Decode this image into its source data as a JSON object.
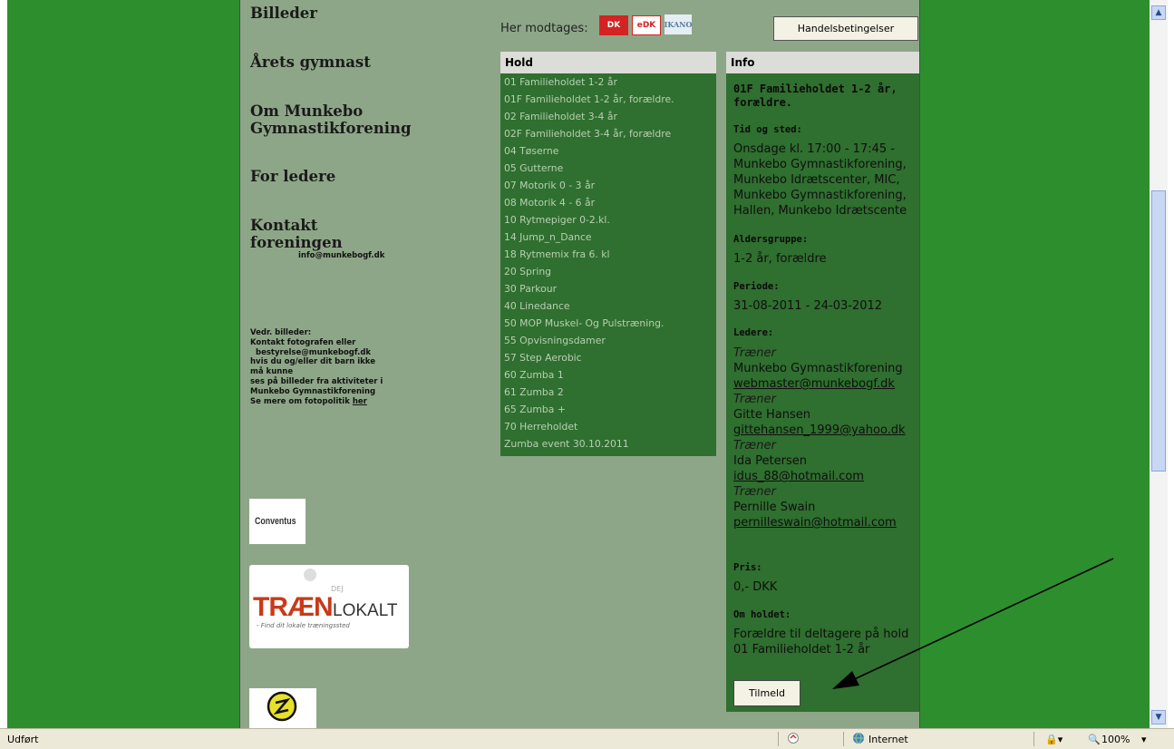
{
  "sidebar": {
    "items": [
      {
        "label": "Billeder"
      },
      {
        "label": "Årets gymnast"
      },
      {
        "label": "Om Munkebo Gymnastikforening"
      },
      {
        "label": "For ledere"
      },
      {
        "label": "Kontakt foreningen"
      }
    ],
    "contact_email": "info@munkebogf.dk",
    "photo_note": {
      "line1": "Vedr. billeder:",
      "line2": "Kontakt fotografen eller",
      "line3": "bestyrelse@munkebogf.dk",
      "line4": "hvis du og/eller dit barn ikke",
      "line5": "må kunne",
      "line6": "ses på billeder fra aktiviteter i",
      "line7": "Munkebo Gymnastikforening",
      "line8_prefix": "Se mere om fotopolitik ",
      "link": "her"
    },
    "logos": {
      "conventus": "Conventus",
      "traen_big": "TRÆN",
      "traen_small": "LOKALT",
      "traen_tagline": "- Find dit lokale træningssted",
      "traen_dej": "DEJ"
    }
  },
  "payment": {
    "label": "Her modtages:",
    "cards": [
      "DK",
      "eDK",
      "IKANO"
    ]
  },
  "terms_button": "Handelsbetingelser",
  "hold": {
    "header": "Hold",
    "items": [
      "01 Familieholdet 1-2 år",
      "01F Familieholdet 1-2 år, forældre.",
      "02 Familieholdet 3-4 år",
      "02F Familieholdet 3-4 år, forældre",
      "04 Tøserne",
      "05 Gutterne",
      "07 Motorik 0 - 3 år",
      "08 Motorik 4 - 6 år",
      "10 Rytmepiger 0-2.kl.",
      "14 Jump_n_Dance",
      "18 Rytmemix fra 6. kl",
      "20 Spring",
      "30 Parkour",
      "40 Linedance",
      "50 MOP Muskel- Og Pulstræning.",
      "55 Opvisningsdamer",
      "57 Step Aerobic",
      "60 Zumba 1",
      "61 Zumba 2",
      "65 Zumba +",
      "70 Herreholdet",
      "Zumba event 30.10.2011"
    ]
  },
  "info": {
    "header": "Info",
    "title_line1": "01F Familieholdet 1-2 år,",
    "title_line2": "forældre.",
    "tid_label": "Tid og sted:",
    "tid_lines": [
      "Onsdage kl. 17:00 - 17:45 -",
      "Munkebo Gymnastikforening,",
      "Munkebo Idrætscenter, MIC,",
      "Munkebo Gymnastikforening,",
      "Hallen, Munkebo Idrætscente"
    ],
    "alder_label": "Aldersgruppe:",
    "alder_value": "1-2 år, forældre",
    "periode_label": "Periode:",
    "periode_value": "31-08-2011 - 24-03-2012",
    "ledere_label": "Ledere:",
    "ledere": [
      {
        "role": "Træner",
        "name": "Munkebo Gymnastikforening",
        "email": "webmaster@munkebogf.dk"
      },
      {
        "role": "Træner",
        "name": "Gitte Hansen",
        "email": "gittehansen_1999@yahoo.dk"
      },
      {
        "role": "Træner",
        "name": "Ida Petersen",
        "email": "idus_88@hotmail.com"
      },
      {
        "role": "Træner",
        "name": "Pernille Swain",
        "email": "pernilleswain@hotmail.com"
      }
    ],
    "pris_label": "Pris:",
    "pris_value": "0,- DKK",
    "om_label": "Om holdet:",
    "om_lines": [
      "Forældre til deltagere på hold",
      "01 Familieholdet 1-2 år"
    ],
    "signup_button": "Tilmeld"
  },
  "statusbar": {
    "left": "Udført",
    "zone": "Internet",
    "zoom": "100%"
  }
}
